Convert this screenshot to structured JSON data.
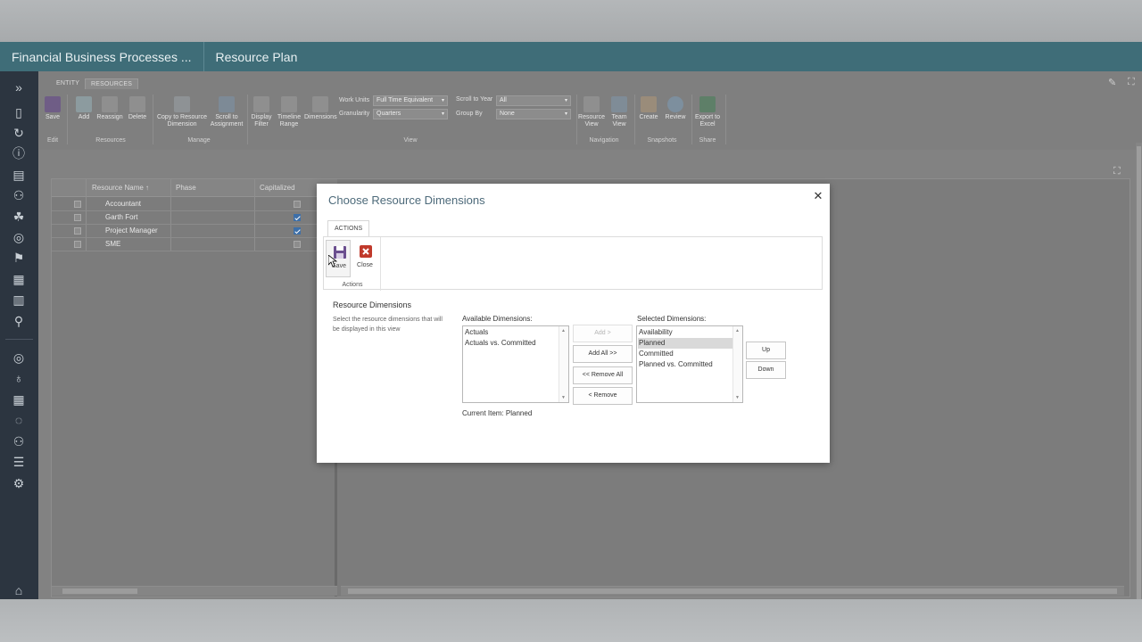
{
  "titlebar": {
    "crumb1": "Financial Business Processes ...",
    "crumb2": "Resource Plan"
  },
  "nav": {
    "icons": [
      "expand-icon",
      "page-icon",
      "sync-icon",
      "info-icon",
      "document-icon",
      "people-icon",
      "team-icon",
      "target-icon",
      "flag-icon",
      "grid-icon",
      "report-icon",
      "attachment-icon",
      "target-icon",
      "lightbulb-icon",
      "table-icon",
      "cycle-icon",
      "user-icon",
      "list-icon",
      "settings-icon",
      "home-icon"
    ]
  },
  "ribbon": {
    "tabs": [
      "ENTITY",
      "RESOURCES"
    ],
    "buttons": {
      "save": "Save",
      "add": "Add",
      "reassign": "Reassign",
      "delete": "Delete",
      "copy": "Copy to Resource Dimension",
      "scroll": "Scroll to Assignment",
      "display_filter": "Display Filter",
      "timeline_range": "Timeline Range",
      "dimensions": "Dimensions",
      "resource_view": "Resource View",
      "team_view": "Team View",
      "create": "Create",
      "review": "Review",
      "export": "Export to Excel"
    },
    "groups": {
      "edit": "Edit",
      "resources": "Resources",
      "manage": "Manage",
      "view": "View",
      "navigation": "Navigation",
      "snapshots": "Snapshots",
      "share": "Share"
    },
    "fields": {
      "work_units_label": "Work Units",
      "work_units_value": "Full Time Equivalent",
      "granularity_label": "Granularity",
      "granularity_value": "Quarters",
      "scroll_year_label": "Scroll to Year",
      "scroll_year_value": "All",
      "group_by_label": "Group By",
      "group_by_value": "None"
    }
  },
  "grid": {
    "headers": {
      "name": "Resource Name ↑",
      "phase": "Phase",
      "capitalized": "Capitalized"
    },
    "rows": [
      {
        "name": "Accountant",
        "capitalized": false
      },
      {
        "name": "Garth Fort",
        "capitalized": true
      },
      {
        "name": "Project Manager",
        "capitalized": true
      },
      {
        "name": "SME",
        "capitalized": false
      }
    ]
  },
  "dialog": {
    "title": "Choose Resource Dimensions",
    "tab": "ACTIONS",
    "save_label": "Save",
    "close_label": "Close",
    "group_label": "Actions",
    "section_title": "Resource Dimensions",
    "section_desc": "Select the resource dimensions that will be displayed in this view",
    "available_label": "Available Dimensions:",
    "available": [
      "Actuals",
      "Actuals vs. Committed"
    ],
    "selected_label": "Selected Dimensions:",
    "selected": [
      "Availability",
      "Planned",
      "Committed",
      "Planned vs. Committed"
    ],
    "selected_item": "Planned",
    "buttons": {
      "add": "Add >",
      "add_all": "Add All >>",
      "remove_all": "<< Remove All",
      "remove": "< Remove",
      "up": "Up",
      "down": "Down"
    },
    "current_item": "Current Item: Planned"
  }
}
